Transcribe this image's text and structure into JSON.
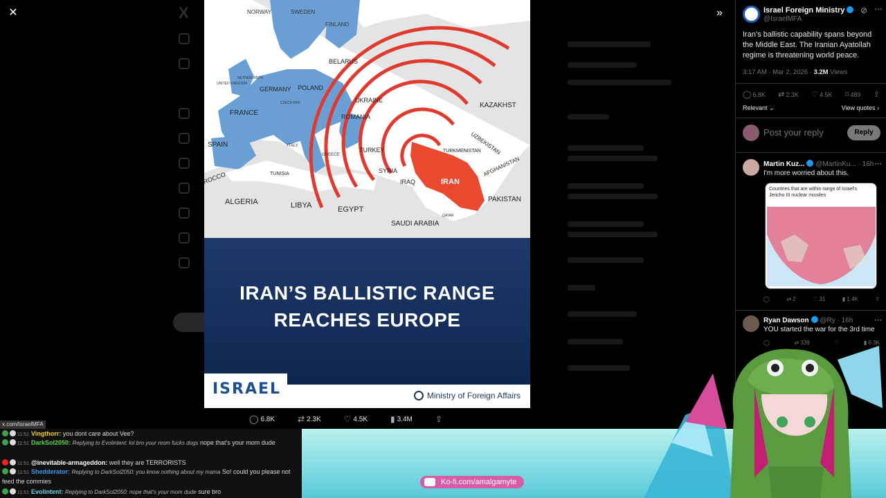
{
  "url_status": "x.com/IsraelMFA",
  "media": {
    "map_labels": {
      "norway": "NORWAY",
      "sweden": "SWEDEN",
      "finland": "FINLAND",
      "germany": "GERMANY",
      "poland": "POLAND",
      "belarus": "BELARUS",
      "ukraine": "UKRAINE",
      "france": "FRANCE",
      "spain": "SPAIN",
      "romania": "ROMANIA",
      "turkey": "TURKEY",
      "syria": "SYRIA",
      "iraq": "IRAQ",
      "iran": "IRAN",
      "kazakhstan": "KAZAKHST",
      "uzbekistan": "UZBEKISTAN",
      "turkmenistan": "TURKMENISTAN",
      "afghanistan": "AFGHANISTAN",
      "pakistan": "PAKISTAN",
      "algeria": "ALGERIA",
      "libya": "LIBYA",
      "egypt": "EGYPT",
      "saudi": "SAUDI ARABIA",
      "tunisia": "TUNISIA",
      "morocco": "ROCCO",
      "uk": "UNITED KINGDOM",
      "netherlands": "NETHERLANDS",
      "czech": "CZECH REP.",
      "italy": "ITALY",
      "greece": "GREECE",
      "qatar": "QATAR"
    },
    "headline_line1": "IRAN’S BALLISTIC RANGE",
    "headline_line2": "REACHES EUROPE",
    "logo_text": "ISRAEL",
    "mfa_text": "Ministry of Foreign Affairs",
    "colors": {
      "range_ring": "#e03a2f",
      "iran_fill": "#e8492f",
      "europe_fill": "#6a9fd6",
      "land": "#e4e4e4",
      "sea": "#ffffff",
      "banner": "#12295a"
    }
  },
  "actions": {
    "replies": "6.8K",
    "reposts": "2.3K",
    "likes": "4.5K",
    "views": "3.4M"
  },
  "panel": {
    "author_name": "Israel Foreign Ministry",
    "author_handle": "@IsraelMFA",
    "tweet_text": "Iran’s ballistic capability spans beyond the Middle East. The Iranian Ayatollah regime is threatening world peace.",
    "time": "3:17 AM · Mar 2, 2026 · ",
    "views_count": "3.2M",
    "views_label": " Views",
    "stats": {
      "replies": "6.8K",
      "reposts": "2.3K",
      "likes": "4.5K",
      "bookmarks": "489"
    },
    "relevant": "Relevant",
    "view_quotes": "View quotes",
    "reply_placeholder": "Post your reply",
    "reply_button": "Reply",
    "comments": [
      {
        "name": "Martin Kuz...",
        "handle": "@MartinKu...",
        "time": "· 16h",
        "text": "I'm more worried about this.",
        "embed_caption": "Countries that are within range of Israel's Jericho III nuclear missiles",
        "stats": {
          "replies": "",
          "reposts": "2",
          "likes": "31",
          "views": "1.4K"
        }
      },
      {
        "name": "Ryan Dawson",
        "handle": "@Ry",
        "time": "· 16h",
        "text": "YOU started the war for the 3rd time",
        "stats": {
          "reposts": "339",
          "views": "6.3K"
        }
      }
    ]
  },
  "chat": [
    {
      "time": "11:51",
      "user": "Vingthorr:",
      "color": "y",
      "text": "you dont care about Vee?"
    },
    {
      "time": "11:51",
      "user": "DarkSol2050:",
      "color": "gr",
      "reply": "Replying to Evolintent: lol bro your mom fucks dogs",
      "text": " nope that's your mom dude"
    },
    {
      "time": "11:51",
      "user": "@inevitable-armageddon:",
      "color": "w",
      "text": " well they are TERRORISTS"
    },
    {
      "time": "11:51",
      "user": "Shedderator:",
      "color": "b",
      "reply": "Replying to DarkSol2050: you know nothing about my mama",
      "text": " So! could you please not feed the commies"
    },
    {
      "time": "11:51",
      "user": "Evolintent:",
      "color": "c",
      "reply": "Replying to DarkSol2050: nope that's your mom dude",
      "text": " sure bro"
    }
  ],
  "kofi": "Ko-fi.com/amalgamyte"
}
